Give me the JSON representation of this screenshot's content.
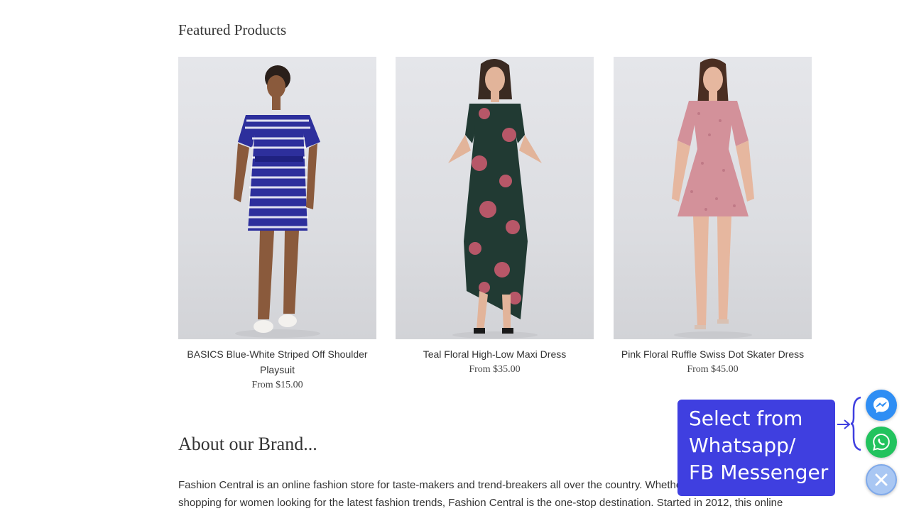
{
  "featured": {
    "title": "Featured Products",
    "products": [
      {
        "name": "BASICS Blue-White Striped Off Shoulder Playsuit",
        "price": "From $15.00"
      },
      {
        "name": "Teal Floral High-Low Maxi Dress",
        "price": "From $35.00"
      },
      {
        "name": "Pink Floral Ruffle Swiss Dot Skater Dress",
        "price": "From $45.00"
      }
    ]
  },
  "about": {
    "title": "About our Brand...",
    "lines": [
      "Fashion Central is an online fashion store for taste-makers and trend-breakers all over the country. Whether you're",
      "shopping for women looking for the latest fashion trends, Fashion Central is the one-stop destination. Started in 2012, this online"
    ]
  },
  "chat_widget": {
    "tooltip_lines": [
      "Select from",
      "Whatsapp/",
      "FB Messenger"
    ],
    "icons": {
      "messenger": "messenger-icon",
      "whatsapp": "whatsapp-icon",
      "close": "close-icon"
    },
    "colors": {
      "tooltip": "#3f3fe0",
      "messenger": "#2f8ef4",
      "whatsapp": "#22c35e",
      "close": "#a9c7f3"
    }
  }
}
